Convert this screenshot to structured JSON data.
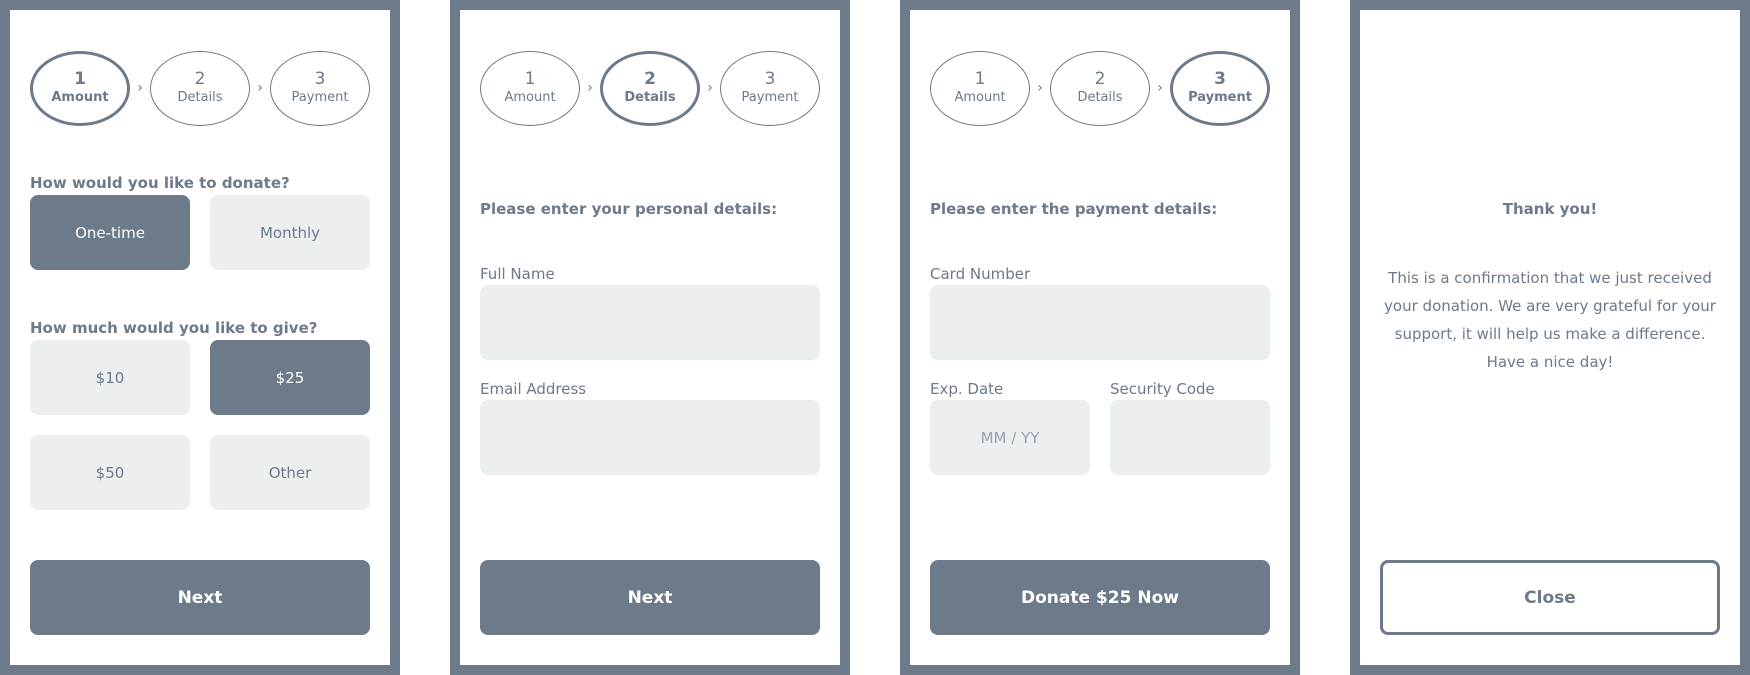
{
  "theme": {
    "primary": "#6d7a89",
    "field_bg": "#ebeff0",
    "text": "#6d7a89"
  },
  "steps": [
    {
      "num": "1",
      "label": "Amount"
    },
    {
      "num": "2",
      "label": "Details"
    },
    {
      "num": "3",
      "label": "Payment"
    }
  ],
  "step_separator_icon": "chevron-right-icon",
  "screen1": {
    "active_step": 1,
    "frequency_question": "How would you like to donate?",
    "frequency_options": [
      {
        "label": "One-time",
        "selected": true
      },
      {
        "label": "Monthly",
        "selected": false
      }
    ],
    "amount_question": "How much would you like to give?",
    "amount_options": [
      {
        "label": "$10",
        "selected": false
      },
      {
        "label": "$25",
        "selected": true
      },
      {
        "label": "$50",
        "selected": false
      },
      {
        "label": "Other",
        "selected": false
      }
    ],
    "next_label": "Next"
  },
  "screen2": {
    "active_step": 2,
    "heading": "Please enter your personal details:",
    "full_name_label": "Full Name",
    "full_name_value": "",
    "email_label": "Email Address",
    "email_value": "",
    "next_label": "Next"
  },
  "screen3": {
    "active_step": 3,
    "heading": "Please enter the payment details:",
    "card_number_label": "Card Number",
    "card_number_value": "",
    "exp_date_label": "Exp. Date",
    "exp_date_placeholder": "MM / YY",
    "security_code_label": "Security Code",
    "security_code_value": "",
    "donate_label": "Donate $25 Now"
  },
  "screen4": {
    "title": "Thank you!",
    "message": "This is a confirmation that we just received your donation. We are very grateful for your support, it will help us make a difference. Have a nice day!",
    "close_label": "Close"
  }
}
